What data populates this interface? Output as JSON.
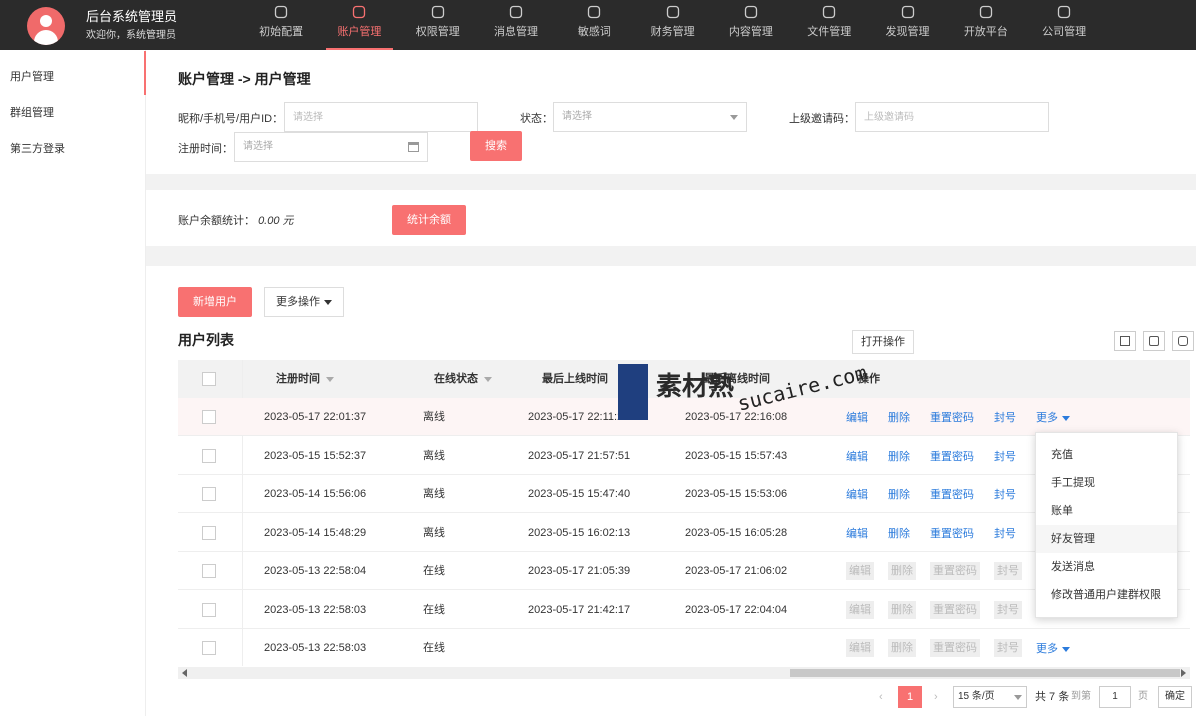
{
  "header": {
    "title": "后台系统管理员",
    "welcome": "欢迎你，系统管理员",
    "nav": [
      {
        "label": "初始配置",
        "icon": "gear-icon"
      },
      {
        "label": "账户管理",
        "icon": "user-icon",
        "active": true
      },
      {
        "label": "权限管理",
        "icon": "lock-icon"
      },
      {
        "label": "消息管理",
        "icon": "message-icon"
      },
      {
        "label": "敏感词",
        "icon": "alert-icon"
      },
      {
        "label": "财务管理",
        "icon": "wallet-icon"
      },
      {
        "label": "内容管理",
        "icon": "document-icon"
      },
      {
        "label": "文件管理",
        "icon": "folder-icon"
      },
      {
        "label": "发现管理",
        "icon": "file-icon"
      },
      {
        "label": "开放平台",
        "icon": "monitor-icon"
      },
      {
        "label": "公司管理",
        "icon": "users-icon"
      }
    ],
    "accent": "#f87171"
  },
  "sidebar": {
    "items": [
      {
        "label": "用户管理",
        "active": true
      },
      {
        "label": "群组管理"
      },
      {
        "label": "第三方登录"
      }
    ]
  },
  "filters": {
    "breadcrumb": "账户管理 -> 用户管理",
    "keyword_label": "昵称/手机号/用户ID：",
    "keyword_placeholder": "请选择",
    "status_label": "状态：",
    "status_placeholder": "请选择",
    "invite_label": "上级邀请码：",
    "invite_placeholder": "上级邀请码",
    "regtime_label": "注册时间：",
    "regtime_placeholder": "请选择",
    "search_button": "搜索"
  },
  "balance": {
    "label": "账户余额统计：",
    "value": "0.00 元",
    "button": "统计余额"
  },
  "list": {
    "add_button": "新增用户",
    "more_ops": "更多操作",
    "title": "用户列表",
    "open_ops": "打开操作",
    "columns": [
      "注册时间",
      "在线状态",
      "最后上线时间",
      "最后离线时间",
      "操作"
    ],
    "actions": {
      "edit": "编辑",
      "delete": "删除",
      "reset": "重置密码",
      "ban": "封号",
      "more": "更多"
    },
    "rows": [
      {
        "reg": "2023-05-17 22:01:37",
        "status": "离线",
        "last_on": "2023-05-17 22:11:21",
        "last_off": "2023-05-17 22:16:08",
        "enabled": true,
        "more": true
      },
      {
        "reg": "2023-05-15 15:52:37",
        "status": "离线",
        "last_on": "2023-05-17 21:57:51",
        "last_off": "2023-05-15 15:57:43",
        "enabled": true,
        "more": false
      },
      {
        "reg": "2023-05-14 15:56:06",
        "status": "离线",
        "last_on": "2023-05-15 15:47:40",
        "last_off": "2023-05-15 15:53:06",
        "enabled": true,
        "more": false
      },
      {
        "reg": "2023-05-14 15:48:29",
        "status": "离线",
        "last_on": "2023-05-15 16:02:13",
        "last_off": "2023-05-15 16:05:28",
        "enabled": true,
        "more": false
      },
      {
        "reg": "2023-05-13 22:58:04",
        "status": "在线",
        "last_on": "2023-05-17 21:05:39",
        "last_off": "2023-05-17 21:06:02",
        "enabled": false,
        "more": false
      },
      {
        "reg": "2023-05-13 22:58:03",
        "status": "在线",
        "last_on": "2023-05-17 21:42:17",
        "last_off": "2023-05-17 22:04:04",
        "enabled": false,
        "more": false
      },
      {
        "reg": "2023-05-13 22:58:03",
        "status": "在线",
        "last_on": "",
        "last_off": "",
        "enabled": false,
        "more": true
      }
    ]
  },
  "dropdown": {
    "items": [
      "充值",
      "手工提现",
      "账单",
      "好友管理",
      "发送消息",
      "修改普通用户建群权限"
    ]
  },
  "pager": {
    "current": "1",
    "page_size": "15 条/页",
    "total": "共 7 条",
    "goto_label": "到第",
    "goto_value": "1",
    "page_unit": "页",
    "confirm": "确定"
  },
  "watermark": {
    "cn": "素材熟",
    "en": "sucaire.com"
  }
}
